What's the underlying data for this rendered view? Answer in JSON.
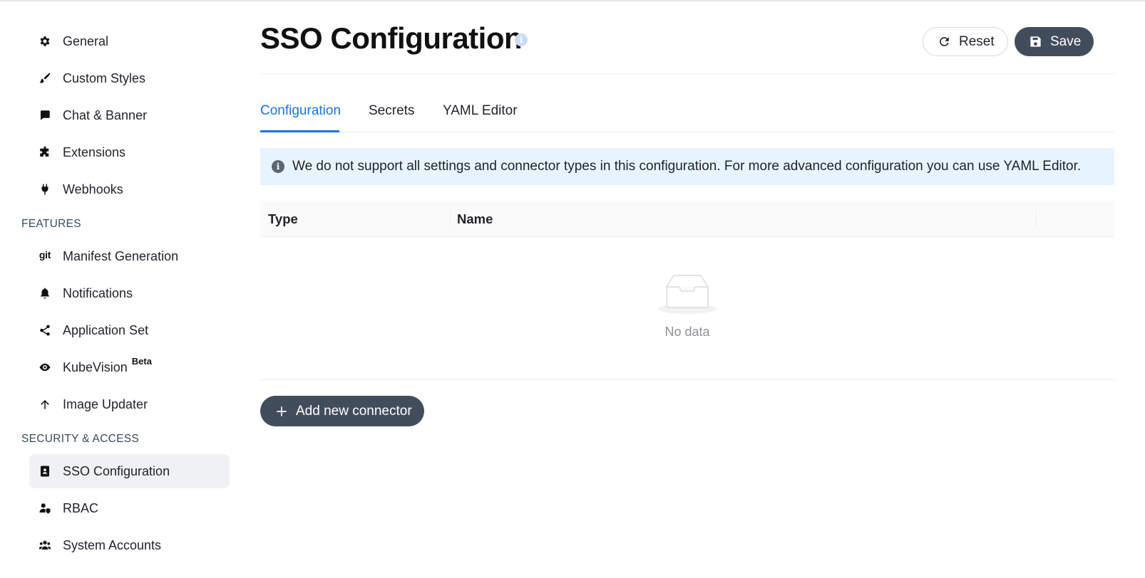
{
  "sidebar": {
    "items": [
      {
        "label": "General",
        "icon": "gear-icon"
      },
      {
        "label": "Custom Styles",
        "icon": "brush-icon"
      },
      {
        "label": "Chat & Banner",
        "icon": "chat-icon"
      },
      {
        "label": "Extensions",
        "icon": "puzzle-icon"
      },
      {
        "label": "Webhooks",
        "icon": "plug-icon"
      }
    ],
    "features_heading": "FEATURES",
    "features": [
      {
        "label": "Manifest Generation",
        "icon": "git-icon",
        "icon_text": "git"
      },
      {
        "label": "Notifications",
        "icon": "bell-icon"
      },
      {
        "label": "Application Set",
        "icon": "share-icon"
      },
      {
        "label": "KubeVision",
        "icon": "eye-icon",
        "badge": "Beta"
      },
      {
        "label": "Image Updater",
        "icon": "arrow-up-icon"
      }
    ],
    "security_heading": "SECURITY & ACCESS",
    "security": [
      {
        "label": "SSO Configuration",
        "icon": "id-badge-icon",
        "active": true
      },
      {
        "label": "RBAC",
        "icon": "user-shield-icon"
      },
      {
        "label": "System Accounts",
        "icon": "users-icon"
      }
    ]
  },
  "header": {
    "title": "SSO Configuration",
    "info_glyph": "i",
    "reset_label": "Reset",
    "save_label": "Save"
  },
  "tabs": [
    {
      "label": "Configuration",
      "active": true
    },
    {
      "label": "Secrets",
      "active": false
    },
    {
      "label": "YAML Editor",
      "active": false
    }
  ],
  "alert": {
    "glyph": "i",
    "text": "We do not support all settings and connector types in this configuration. For more advanced configuration you can use YAML Editor."
  },
  "table": {
    "columns": [
      "Type",
      "Name"
    ],
    "rows": [],
    "empty_text": "No data"
  },
  "add_button": {
    "label": "Add new connector"
  },
  "colors": {
    "accent": "#1a73e8",
    "primary_button": "#424d5c",
    "alert_bg": "#e8f4fd"
  }
}
